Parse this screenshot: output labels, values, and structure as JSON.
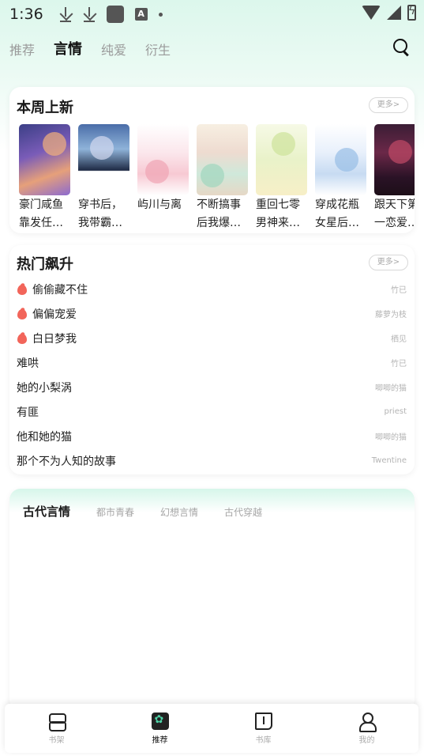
{
  "status_bar": {
    "time": "1:36",
    "a_badge": "A"
  },
  "top_tabs": [
    "推荐",
    "言情",
    "纯爱",
    "衍生"
  ],
  "new_this_week": {
    "title": "本周上新",
    "more": "更多>",
    "books": [
      {
        "title": "豪门咸鱼",
        "subtitle": "靠发任…"
      },
      {
        "title": "穿书后，",
        "subtitle": "我带霸…"
      },
      {
        "title": "屿川与离",
        "subtitle": ""
      },
      {
        "title": "不断搞事",
        "subtitle": "后我爆…"
      },
      {
        "title": "重回七零",
        "subtitle": "男神来…"
      },
      {
        "title": "穿成花瓶",
        "subtitle": "女星后…"
      },
      {
        "title": "跟天下第",
        "subtitle": "一恋爱…"
      }
    ]
  },
  "hot_rising": {
    "title": "热门飙升",
    "more": "更多>",
    "items": [
      {
        "name": "偷偷藏不住",
        "author": "竹已",
        "hot": true
      },
      {
        "name": "偏偏宠爱",
        "author": "藤萝为枝",
        "hot": true
      },
      {
        "name": "白日梦我",
        "author": "栖见",
        "hot": true
      },
      {
        "name": "难哄",
        "author": "竹已",
        "hot": false
      },
      {
        "name": "她的小梨涡",
        "author": "唧唧的猫",
        "hot": false
      },
      {
        "name": "有匪",
        "author": "priest",
        "hot": false
      },
      {
        "name": "他和她的猫",
        "author": "唧唧的猫",
        "hot": false
      },
      {
        "name": "那个不为人知的故事",
        "author": "Twentine",
        "hot": false
      }
    ]
  },
  "category_tabs": [
    "古代言情",
    "都市青春",
    "幻想言情",
    "古代穿越"
  ],
  "bottom_nav": [
    "书架",
    "推荐",
    "书库",
    "我的"
  ],
  "colors": {
    "accent": "#35b893",
    "fire": "#f2655a",
    "bg_top": "#dcf7ec"
  }
}
